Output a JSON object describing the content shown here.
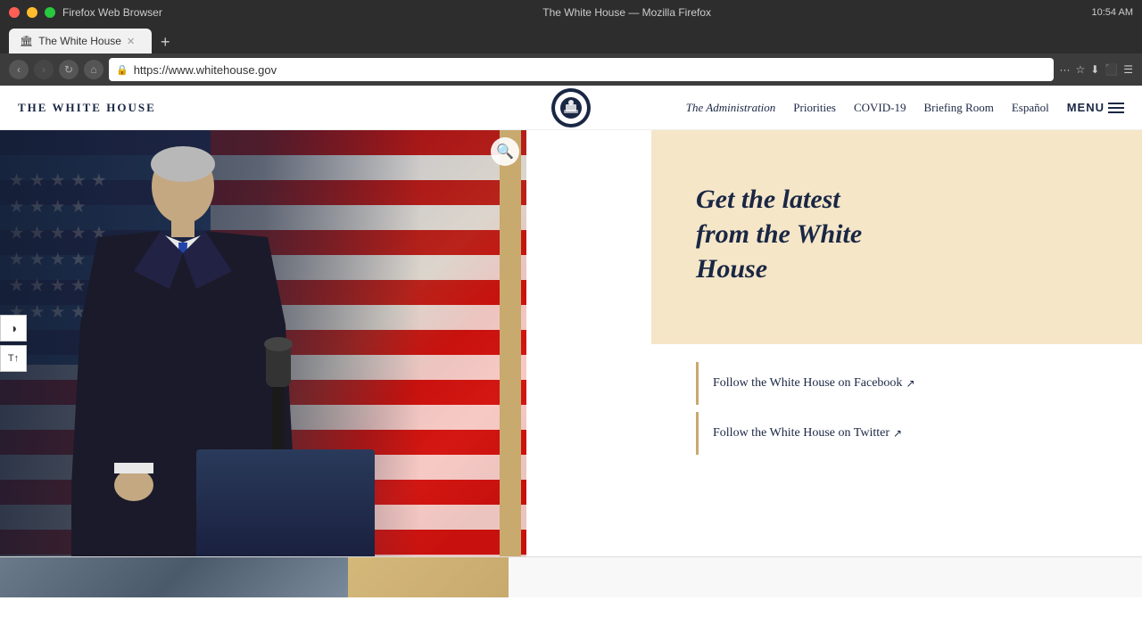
{
  "os": {
    "titlebar": {
      "app_name": "Firefox Web Browser",
      "window_title": "The White House — Mozilla Firefox",
      "time": "10:54 AM",
      "traffic_lights": [
        "red",
        "yellow",
        "green"
      ]
    }
  },
  "browser": {
    "tab": {
      "title": "The White House",
      "favicon": "🏛"
    },
    "address_bar": {
      "url": "https://www.whitehouse.gov",
      "protocol": "https"
    },
    "new_tab_label": "+"
  },
  "site": {
    "logo": "THE WHITE HOUSE",
    "nav": {
      "links": [
        {
          "label": "The Administration",
          "id": "admin"
        },
        {
          "label": "Priorities",
          "id": "priorities"
        },
        {
          "label": "COVID-19",
          "id": "covid"
        },
        {
          "label": "Briefing Room",
          "id": "briefing"
        },
        {
          "label": "Español",
          "id": "espanol"
        }
      ],
      "menu_label": "MENU"
    },
    "hero": {
      "title_line1": "Get the latest",
      "title_line2": "from the White",
      "title_line3": "House",
      "social_links": [
        {
          "label": "Follow the White House on Facebook",
          "arrow": "↗",
          "id": "facebook"
        },
        {
          "label": "Follow the White House on Twitter",
          "arrow": "↗",
          "id": "twitter"
        }
      ]
    },
    "accessibility": {
      "contrast_btn": "◑",
      "text_btn": "T↑"
    }
  }
}
